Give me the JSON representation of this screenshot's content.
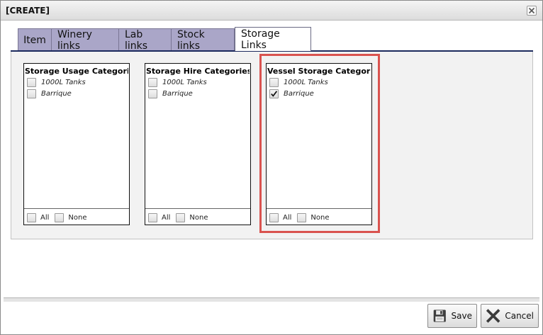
{
  "dialog": {
    "title": "[CREATE]"
  },
  "tabs": [
    {
      "label": "Item",
      "active": false
    },
    {
      "label": "Winery links",
      "active": false
    },
    {
      "label": "Lab links",
      "active": false
    },
    {
      "label": "Stock links",
      "active": false
    },
    {
      "label": "Storage Links",
      "active": true
    }
  ],
  "lists": [
    {
      "title": "Storage Usage Categories",
      "items": [
        {
          "label": "1000L Tanks",
          "checked": false
        },
        {
          "label": "Barrique",
          "checked": false
        }
      ],
      "footer": {
        "all_label": "All",
        "none_label": "None"
      }
    },
    {
      "title": "Storage Hire Categories",
      "items": [
        {
          "label": "1000L Tanks",
          "checked": false
        },
        {
          "label": "Barrique",
          "checked": false
        }
      ],
      "footer": {
        "all_label": "All",
        "none_label": "None"
      }
    },
    {
      "title": "Vessel Storage Categories",
      "items": [
        {
          "label": "1000L Tanks",
          "checked": false
        },
        {
          "label": "Barrique",
          "checked": true
        }
      ],
      "footer": {
        "all_label": "All",
        "none_label": "None"
      }
    }
  ],
  "buttons": {
    "save_label": "Save",
    "cancel_label": "Cancel"
  },
  "colors": {
    "tab_inactive": "#aaa6c8",
    "highlight": "#d9534f",
    "tab_underline": "#1c2a5e"
  },
  "icons": {
    "close": "close-icon",
    "save": "floppy-disk-icon",
    "cancel": "x-icon"
  }
}
